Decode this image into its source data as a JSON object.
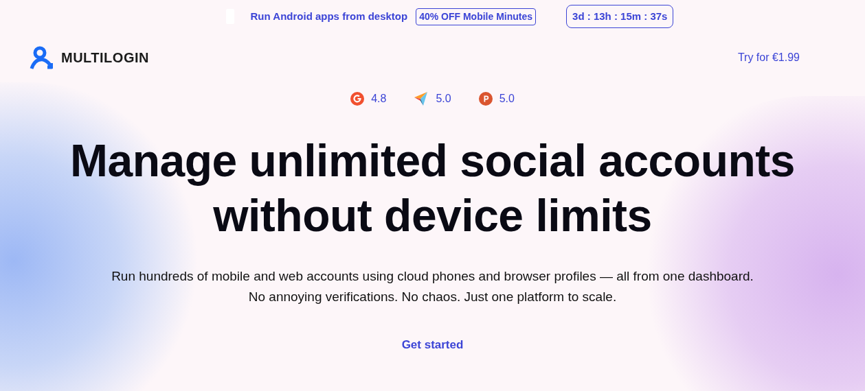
{
  "promo_bar": {
    "text": "Run Android apps from desktop",
    "badge": "40% OFF Mobile Minutes",
    "countdown": "3d : 13h : 15m : 37s"
  },
  "header": {
    "logo": "MULTILOGIN",
    "cta": "Try for €1.99"
  },
  "ratings": [
    {
      "kind": "g2",
      "score": "4.8"
    },
    {
      "kind": "capterra",
      "score": "5.0"
    },
    {
      "kind": "producthunt",
      "score": "5.0"
    }
  ],
  "hero": {
    "title_lines": [
      "Manage unlimited social accounts",
      "without device limits"
    ],
    "subtitle_lines": [
      "Run hundreds of mobile and web accounts using cloud phones and browser profiles — all from one dashboard.",
      "No annoying verifications. No chaos. Just one platform to scale."
    ],
    "cta": "Get started"
  }
}
